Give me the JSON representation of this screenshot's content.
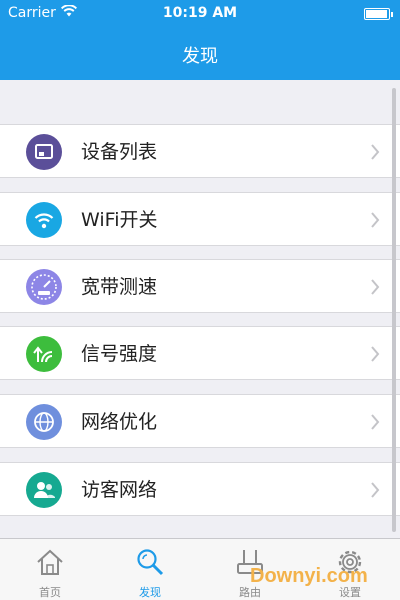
{
  "status_bar": {
    "carrier": "Carrier",
    "time": "10:19 AM"
  },
  "header": {
    "title": "发现"
  },
  "menu": {
    "items": [
      {
        "label": "设备列表",
        "icon": "device-list-icon",
        "color": "#5b4f99"
      },
      {
        "label": "WiFi开关",
        "icon": "wifi-icon",
        "color": "#19a7e3"
      },
      {
        "label": "宽带测速",
        "icon": "speedometer-icon",
        "color": "#8d86e6"
      },
      {
        "label": "信号强度",
        "icon": "signal-strength-icon",
        "color": "#3dbd3d"
      },
      {
        "label": "网络优化",
        "icon": "globe-icon",
        "color": "#6f8fdd"
      },
      {
        "label": "访客网络",
        "icon": "guest-users-icon",
        "color": "#16a991"
      }
    ]
  },
  "tabbar": {
    "tabs": [
      {
        "label": "首页",
        "icon": "home-icon",
        "active": false
      },
      {
        "label": "发现",
        "icon": "search-icon",
        "active": true
      },
      {
        "label": "路由",
        "icon": "router-icon",
        "active": false
      },
      {
        "label": "设置",
        "icon": "gear-icon",
        "active": false
      }
    ]
  },
  "watermark": "Downyi.com",
  "colors": {
    "accent": "#1e9be8",
    "background": "#efeff4"
  }
}
